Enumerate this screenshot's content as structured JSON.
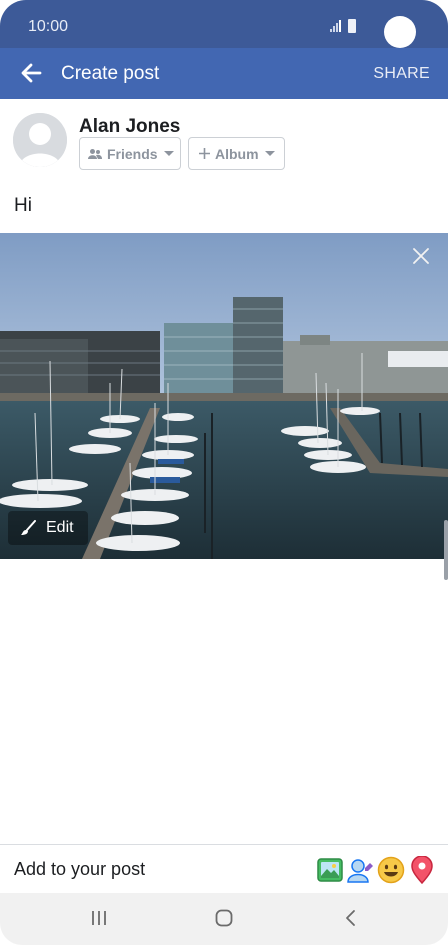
{
  "status": {
    "time": "10:00"
  },
  "header": {
    "title": "Create post",
    "share_label": "SHARE"
  },
  "user": {
    "name": "Alan Jones"
  },
  "audience": {
    "friends_label": "Friends",
    "album_label": "Album"
  },
  "post": {
    "text": "Hi"
  },
  "photo": {
    "edit_label": "Edit"
  },
  "bottom": {
    "add_label": "Add to your post",
    "icons": [
      "photo-icon",
      "tag-people-icon",
      "feeling-icon",
      "check-in-icon"
    ]
  },
  "colors": {
    "brand": "#4267b2",
    "status_bar": "#3d5a98"
  }
}
